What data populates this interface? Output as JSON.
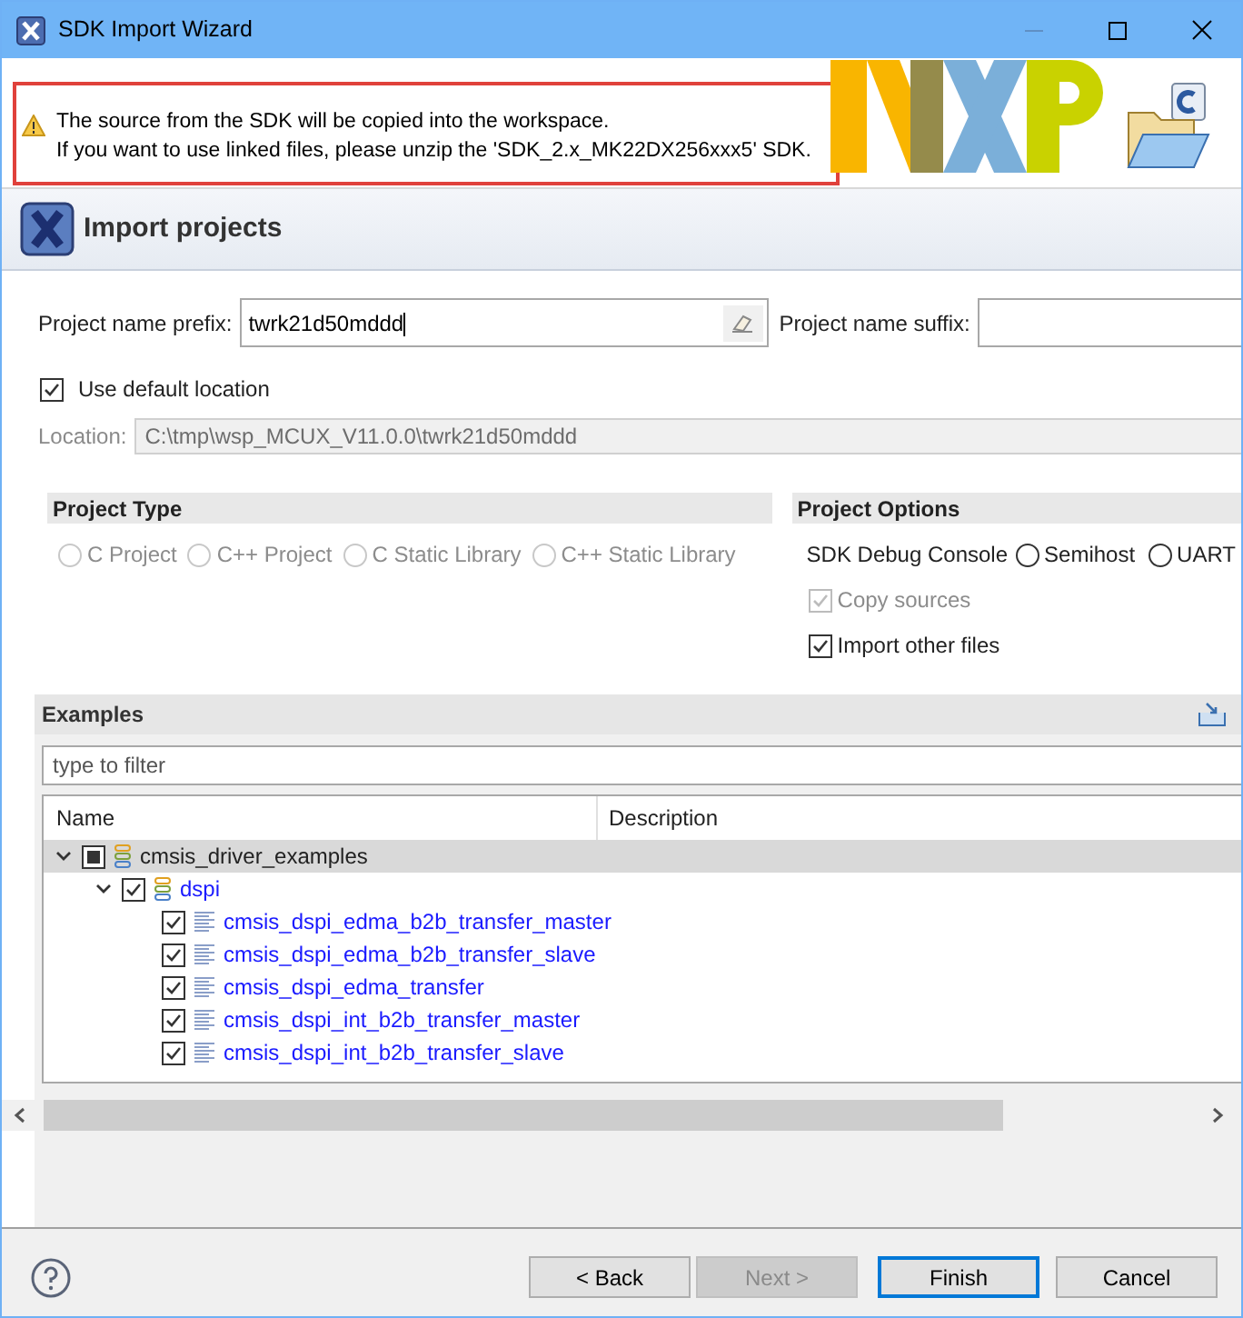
{
  "window": {
    "title": "SDK Import Wizard"
  },
  "banner": {
    "warning": [
      "The source from the SDK will be copied into the workspace.",
      "If you want to use linked files, please unzip the 'SDK_2.x_MK22DX256xxx5' SDK."
    ]
  },
  "page_title": "Import projects",
  "prefix": {
    "label": "Project name prefix:",
    "value": "twrk21d50mddd"
  },
  "suffix": {
    "label": "Project name suffix:"
  },
  "use_default_location": {
    "label": "Use default location",
    "checked": true
  },
  "location": {
    "label": "Location:",
    "value": "C:\\tmp\\wsp_MCUX_V11.0.0\\twrk21d50mddd",
    "disabled": true
  },
  "project_type": {
    "title": "Project Type",
    "disabled": true,
    "options": [
      {
        "label": "C Project",
        "selected": false
      },
      {
        "label": "C++ Project",
        "selected": false
      },
      {
        "label": "C Static Library",
        "selected": false
      },
      {
        "label": "C++ Static Library",
        "selected": false
      }
    ]
  },
  "project_options": {
    "title": "Project Options",
    "console_label": "SDK Debug Console",
    "console_options": [
      {
        "label": "Semihost",
        "selected": false
      },
      {
        "label": "UART",
        "selected": false
      }
    ],
    "checkboxes": [
      {
        "label": "Copy sources",
        "checked": true,
        "disabled": true
      },
      {
        "label": "Import other files",
        "checked": true,
        "disabled": false
      }
    ]
  },
  "examples": {
    "title": "Examples",
    "filter_placeholder": "type to filter",
    "columns": [
      "Name",
      "Description"
    ],
    "tree": [
      {
        "name": "cmsis_driver_examples",
        "kind": "group",
        "expanded": true,
        "checked": true,
        "partial": true,
        "selected": true,
        "children": [
          {
            "name": "dspi",
            "kind": "group",
            "expanded": true,
            "checked": true,
            "partial": false,
            "selected": false,
            "children": [
              {
                "name": "cmsis_dspi_edma_b2b_transfer_master",
                "kind": "example",
                "checked": true,
                "partial": false,
                "selected": false
              },
              {
                "name": "cmsis_dspi_edma_b2b_transfer_slave",
                "kind": "example",
                "checked": true,
                "partial": false,
                "selected": false
              },
              {
                "name": "cmsis_dspi_edma_transfer",
                "kind": "example",
                "checked": true,
                "partial": false,
                "selected": false
              },
              {
                "name": "cmsis_dspi_int_b2b_transfer_master",
                "kind": "example",
                "checked": true,
                "partial": false,
                "selected": false
              },
              {
                "name": "cmsis_dspi_int_b2b_transfer_slave",
                "kind": "example",
                "checked": true,
                "partial": false,
                "selected": false
              }
            ]
          }
        ]
      }
    ]
  },
  "buttons": [
    {
      "label": "< Back",
      "disabled": false,
      "default": false
    },
    {
      "label": "Next >",
      "disabled": true,
      "default": false
    },
    {
      "label": "Finish",
      "disabled": false,
      "default": true
    },
    {
      "label": "Cancel",
      "disabled": false,
      "default": false
    }
  ]
}
